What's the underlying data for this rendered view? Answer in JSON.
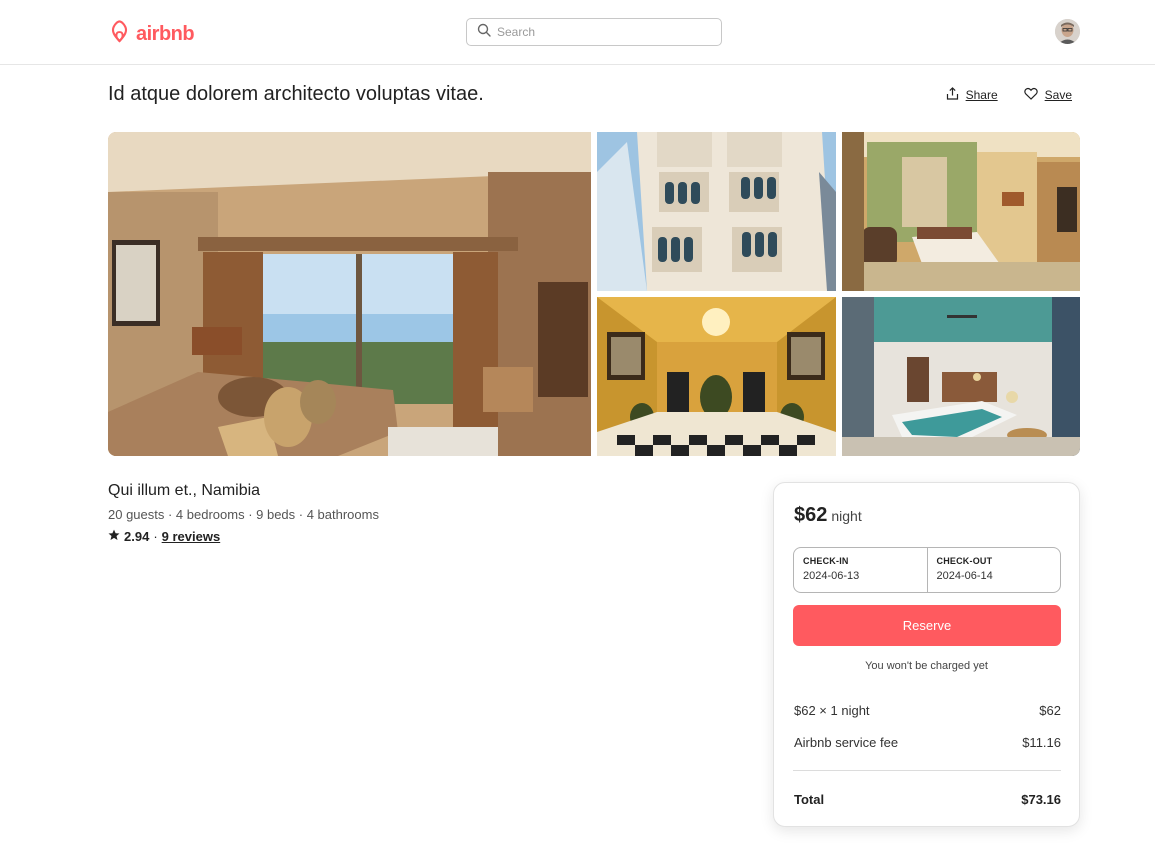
{
  "header": {
    "brand": "airbnb",
    "search_placeholder": "Search"
  },
  "listing": {
    "title": "Id atque dolorem architecto voluptas vitae.",
    "location": "Qui illum et., Namibia",
    "details": "20 guests · 4 bedrooms · 9 beds · 4 bathrooms",
    "rating": "2.94",
    "separator": "·",
    "reviews": "9 reviews"
  },
  "actions": {
    "share": "Share",
    "save": "Save"
  },
  "booking": {
    "price": "$62",
    "price_unit": "night",
    "checkin_label": "CHECK-IN",
    "checkin_value": "2024-06-13",
    "checkout_label": "CHECK-OUT",
    "checkout_value": "2024-06-14",
    "reserve_label": "Reserve",
    "note": "You won't be charged yet",
    "line1_label": "$62 × 1 night",
    "line1_value": "$62",
    "line2_label": "Airbnb service fee",
    "line2_value": "$11.16",
    "total_label": "Total",
    "total_value": "$73.16"
  },
  "colors": {
    "brand": "#ff5a5f",
    "text": "#222222"
  },
  "icons": [
    "airbnb-logo-icon",
    "search-icon",
    "share-icon",
    "heart-icon",
    "star-icon"
  ]
}
